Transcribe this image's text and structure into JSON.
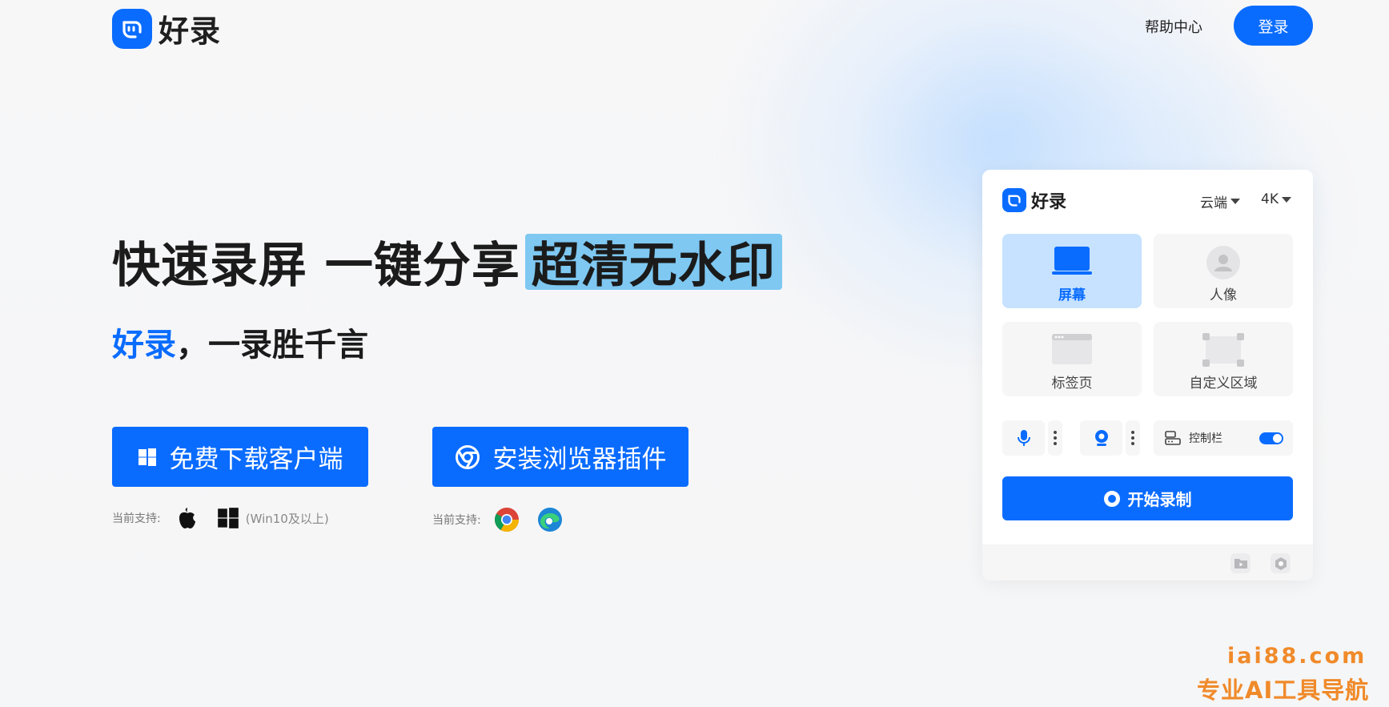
{
  "header": {
    "logo_text": "好录",
    "help_label": "帮助中心",
    "login_label": "登录"
  },
  "hero": {
    "headline_main": "快速录屏 一键分享",
    "headline_highlight": "超清无水印",
    "sub_brand": "好录",
    "sub_rest": "，一录胜千言"
  },
  "cta": {
    "download_label": "免费下载客户端",
    "extension_label": "安装浏览器插件"
  },
  "support": {
    "label_desktop": "当前支持:",
    "desktop_requirement": "(Win10及以上)",
    "label_browser": "当前支持:"
  },
  "recorder": {
    "title": "好录",
    "storage_value": "云端",
    "quality_value": "4K",
    "modes": [
      {
        "label": "屏幕",
        "active": true
      },
      {
        "label": "人像",
        "active": false
      },
      {
        "label": "标签页",
        "active": false
      },
      {
        "label": "自定义区域",
        "active": false
      }
    ],
    "control_bar_label": "控制栏",
    "control_bar_on": true,
    "start_label": "开始录制"
  },
  "watermark": {
    "domain": "iai88.com",
    "slogan": "专业AI工具导航"
  },
  "colors": {
    "brand_blue": "#0a6cff",
    "highlight": "#7ec8f2",
    "watermark_orange": "#f08a2a"
  }
}
